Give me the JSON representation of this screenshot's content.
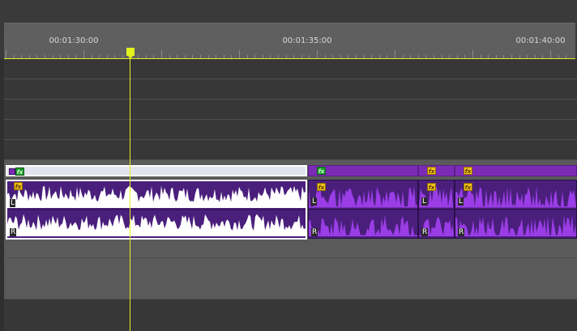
{
  "ruler": {
    "timecodes": [
      {
        "label": "00:01:30:00"
      },
      {
        "label": "00:01:35:00"
      },
      {
        "label": "00:01:40:00"
      }
    ]
  },
  "clips": {
    "fx_label": "fx",
    "channel_left": "L",
    "channel_right": "R",
    "selected_clip_name": "audio-clip-selected",
    "clip_count": 4
  },
  "colors": {
    "accent_yellow": "#e3f11f",
    "clip_purple": "#7b2bb5",
    "clip_selected_bg": "#ffffff",
    "fx_badge": "#f2c21a",
    "fx_badge_green": "#1f9a2e",
    "waveform_purple": "#9a3de6",
    "waveform_white": "#ffffff"
  }
}
